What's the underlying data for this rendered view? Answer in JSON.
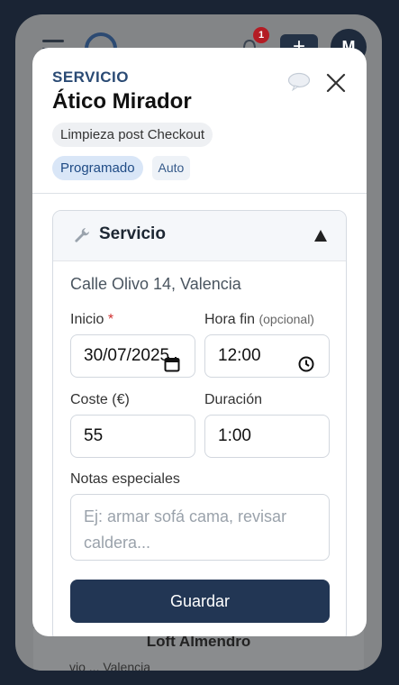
{
  "background": {
    "notification_count": "1",
    "plus_label": "+",
    "avatar_initial": "M",
    "card_title": "Loft Almendro",
    "card_subtitle": "vio ... Valencia"
  },
  "modal": {
    "kicker": "SERVICIO",
    "title": "Ático Mirador",
    "chip": "Limpieza post Checkout",
    "tags": [
      "Programado",
      "Auto"
    ],
    "section": {
      "title": "Servicio",
      "address": "Calle Olivo 14, Valencia",
      "start_label": "Inicio",
      "start_required": "*",
      "start_value": "30/07/2025",
      "end_label": "Hora fin",
      "end_optional": "(opcional)",
      "end_value": "12:00",
      "cost_label": "Coste (€)",
      "cost_value": "55",
      "duration_label": "Duración",
      "duration_value": "1:00",
      "notes_label": "Notas especiales",
      "notes_placeholder": "Ej: armar sofá cama, revisar caldera...",
      "save_label": "Guardar"
    }
  },
  "colors": {
    "accent": "#223654",
    "kicker": "#2a4a74",
    "tag_blue_bg": "#d9e6f7",
    "required": "#d03030"
  },
  "icons": [
    "hamburger-icon",
    "logo-icon",
    "bell-icon",
    "chat-bubble-icon",
    "close-icon",
    "wrench-icon",
    "collapse-up-icon",
    "calendar-icon",
    "clock-icon"
  ]
}
